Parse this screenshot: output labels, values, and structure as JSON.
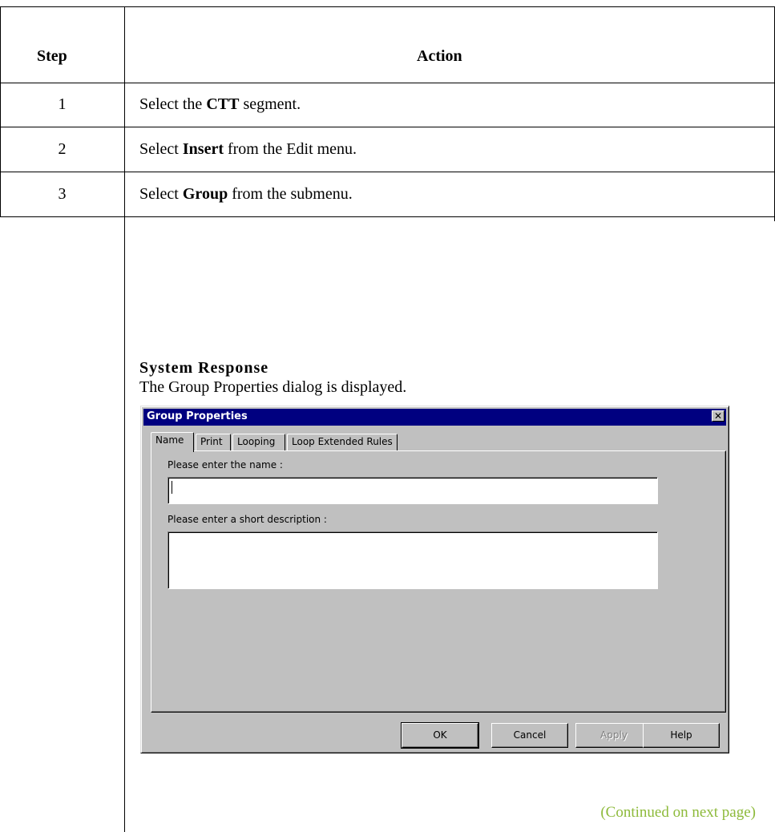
{
  "table": {
    "header": {
      "step": "Step",
      "action": "Action"
    },
    "rows": [
      {
        "step": "1",
        "pre": "Select the ",
        "bold": "CTT",
        "post": " segment."
      },
      {
        "step": "2",
        "pre": "Select ",
        "bold": "Insert",
        "post": " from the Edit menu."
      },
      {
        "step": "3",
        "pre": "Select ",
        "bold": "Group",
        "post": " from the submenu."
      }
    ],
    "system_response_heading": "System Response",
    "system_response_text": "The Group Properties dialog is displayed.",
    "continued": "(Continued on next page)"
  },
  "dialog": {
    "title": "Group Properties",
    "close_glyph": "✕",
    "tabs": [
      {
        "label": "Name",
        "active": true
      },
      {
        "label": "Print",
        "active": false
      },
      {
        "label": "Looping",
        "active": false
      },
      {
        "label": "Loop Extended Rules",
        "active": false
      }
    ],
    "name_label": "Please enter the name :",
    "name_value": "",
    "description_label": "Please enter a short description :",
    "description_value": "",
    "buttons": {
      "ok": "OK",
      "cancel": "Cancel",
      "apply": "Apply",
      "help": "Help"
    }
  },
  "colors": {
    "titlebar": "#000080",
    "dialog_face": "#c0c0c0",
    "continued_text": "#8dba3a"
  }
}
